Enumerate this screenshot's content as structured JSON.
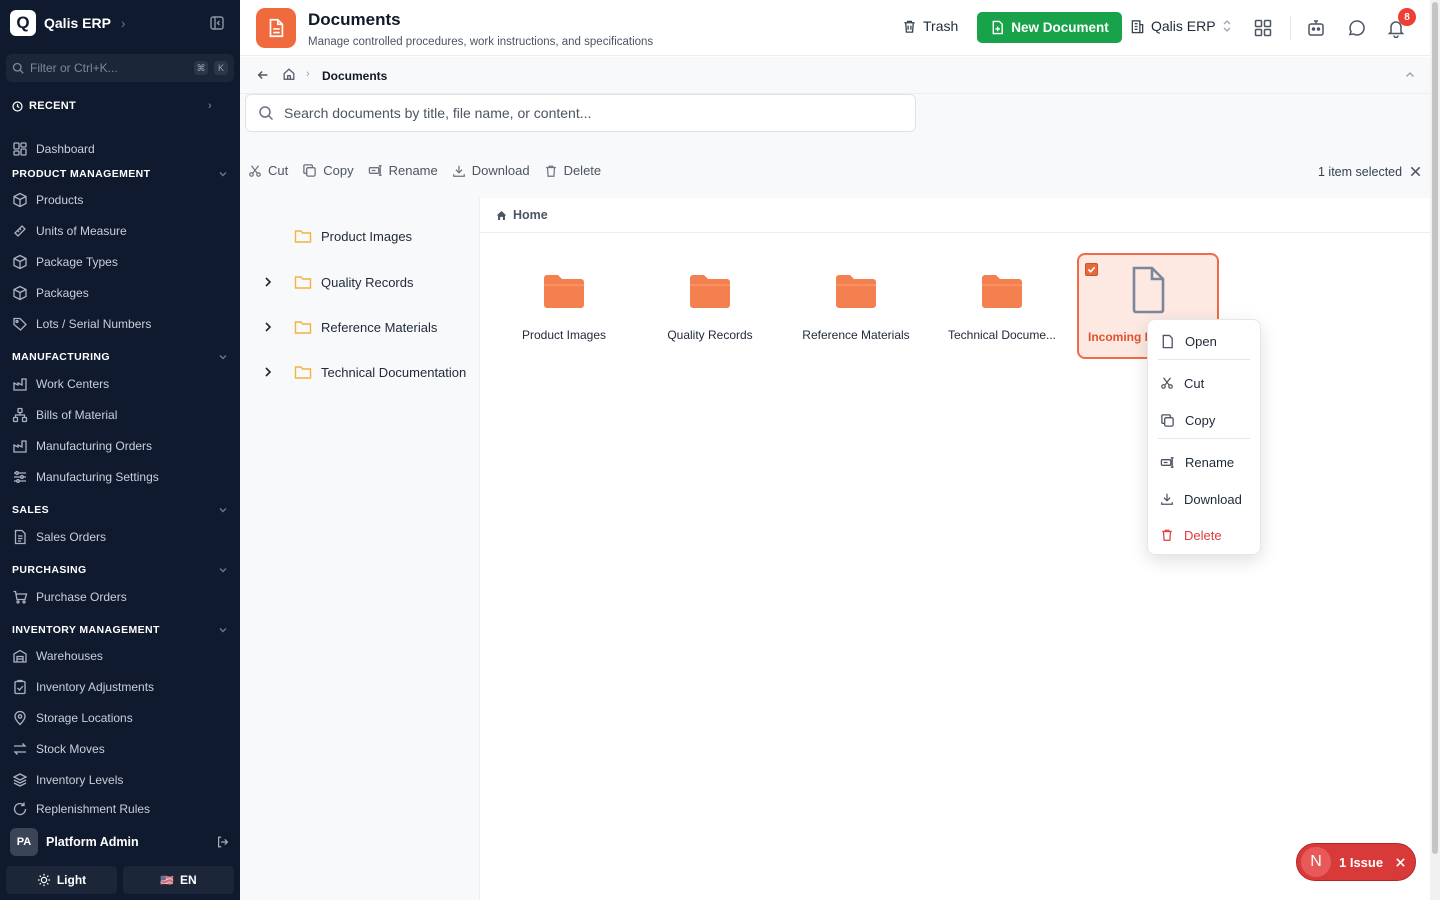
{
  "sidebar": {
    "brand": {
      "logo_letter": "Q",
      "name": "Qalis ERP"
    },
    "filter": {
      "placeholder": "Filter or Ctrl+K...",
      "kbd1": "⌘",
      "kbd2": "K"
    },
    "recent_label": "RECENT",
    "dashboard": "Dashboard",
    "sections": [
      {
        "title": "PRODUCT MANAGEMENT",
        "items": [
          "Products",
          "Units of Measure",
          "Package Types",
          "Packages",
          "Lots / Serial Numbers"
        ]
      },
      {
        "title": "MANUFACTURING",
        "items": [
          "Work Centers",
          "Bills of Material",
          "Manufacturing Orders",
          "Manufacturing Settings"
        ]
      },
      {
        "title": "SALES",
        "items": [
          "Sales Orders"
        ]
      },
      {
        "title": "PURCHASING",
        "items": [
          "Purchase Orders"
        ]
      },
      {
        "title": "INVENTORY MANAGEMENT",
        "items": [
          "Warehouses",
          "Inventory Adjustments",
          "Storage Locations",
          "Stock Moves",
          "Inventory Levels",
          "Replenishment Rules"
        ]
      }
    ],
    "user": {
      "initials": "PA",
      "name": "Platform Admin"
    },
    "theme_label": "Light",
    "lang_flag": "🇺🇸",
    "lang_label": "EN"
  },
  "header": {
    "title": "Documents",
    "subtitle": "Manage controlled procedures, work instructions, and specifications",
    "trash_label": "Trash",
    "new_doc_label": "New Document",
    "org_label": "Qalis ERP",
    "notification_count": "8"
  },
  "breadcrumb": {
    "current": "Documents"
  },
  "search": {
    "placeholder": "Search documents by title, file name, or content..."
  },
  "toolbar": {
    "cut": "Cut",
    "copy": "Copy",
    "rename": "Rename",
    "download": "Download",
    "delete": "Delete",
    "selected_text": "1 item selected"
  },
  "tree": [
    {
      "label": "Product Images",
      "expandable": false
    },
    {
      "label": "Quality Records",
      "expandable": true
    },
    {
      "label": "Reference Materials",
      "expandable": true
    },
    {
      "label": "Technical Documentation",
      "expandable": true
    }
  ],
  "content": {
    "crumb": "Home",
    "tiles": [
      {
        "label": "Product Images",
        "kind": "folder"
      },
      {
        "label": "Quality Records",
        "kind": "folder"
      },
      {
        "label": "Reference Materials",
        "kind": "folder"
      },
      {
        "label": "Technical Docume...",
        "kind": "folder"
      },
      {
        "label": "Incoming I",
        "kind": "file",
        "selected": true
      }
    ]
  },
  "context_menu": {
    "open": "Open",
    "cut": "Cut",
    "copy": "Copy",
    "rename": "Rename",
    "download": "Download",
    "delete": "Delete"
  },
  "issue_toast": {
    "letter": "N",
    "label": "1 Issue"
  },
  "colors": {
    "accent": "#f06a3d",
    "primary_green": "#18a34a",
    "sidebar_bg": "#0f1a2e",
    "danger": "#e23b3b"
  }
}
